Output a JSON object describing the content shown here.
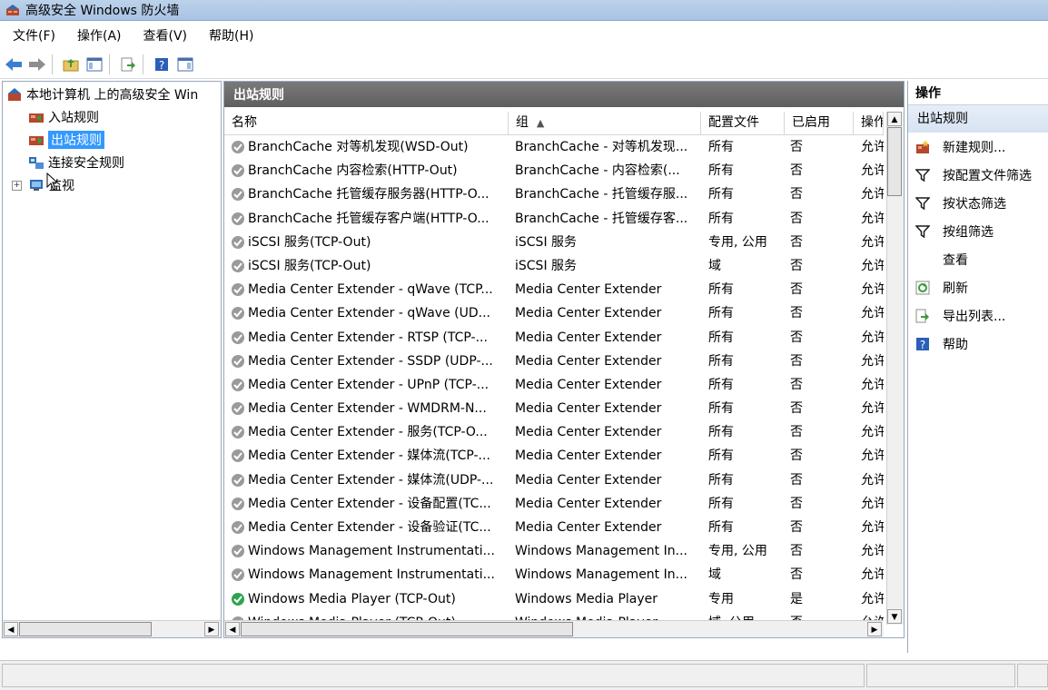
{
  "window": {
    "title": "高级安全 Windows 防火墙"
  },
  "menu": [
    "文件(F)",
    "操作(A)",
    "查看(V)",
    "帮助(H)"
  ],
  "tree": {
    "root": "本地计算机 上的高级安全 Win",
    "inbound": "入站规则",
    "outbound": "出站规则",
    "connection": "连接安全规则",
    "monitor": "监视",
    "expander": "+"
  },
  "center": {
    "title": "出站规则",
    "columns": [
      "名称",
      "组",
      "配置文件",
      "已启用",
      "操作"
    ],
    "sort_indicator": "▲",
    "rows": [
      {
        "name": "BranchCache 对等机发现(WSD-Out)",
        "group": "BranchCache - 对等机发现...",
        "profile": "所有",
        "enabled": "否",
        "action": "允许"
      },
      {
        "name": "BranchCache 内容检索(HTTP-Out)",
        "group": "BranchCache - 内容检索(...",
        "profile": "所有",
        "enabled": "否",
        "action": "允许"
      },
      {
        "name": "BranchCache 托管缓存服务器(HTTP-O...",
        "group": "BranchCache - 托管缓存服...",
        "profile": "所有",
        "enabled": "否",
        "action": "允许"
      },
      {
        "name": "BranchCache 托管缓存客户端(HTTP-O...",
        "group": "BranchCache - 托管缓存客...",
        "profile": "所有",
        "enabled": "否",
        "action": "允许"
      },
      {
        "name": "iSCSI 服务(TCP-Out)",
        "group": "iSCSI 服务",
        "profile": "专用, 公用",
        "enabled": "否",
        "action": "允许"
      },
      {
        "name": "iSCSI 服务(TCP-Out)",
        "group": "iSCSI 服务",
        "profile": "域",
        "enabled": "否",
        "action": "允许"
      },
      {
        "name": "Media Center Extender - qWave (TCP...",
        "group": "Media Center Extender",
        "profile": "所有",
        "enabled": "否",
        "action": "允许"
      },
      {
        "name": "Media Center Extender - qWave (UD...",
        "group": "Media Center Extender",
        "profile": "所有",
        "enabled": "否",
        "action": "允许"
      },
      {
        "name": "Media Center Extender - RTSP (TCP-...",
        "group": "Media Center Extender",
        "profile": "所有",
        "enabled": "否",
        "action": "允许"
      },
      {
        "name": "Media Center Extender - SSDP (UDP-...",
        "group": "Media Center Extender",
        "profile": "所有",
        "enabled": "否",
        "action": "允许"
      },
      {
        "name": "Media Center Extender - UPnP (TCP-...",
        "group": "Media Center Extender",
        "profile": "所有",
        "enabled": "否",
        "action": "允许"
      },
      {
        "name": "Media Center Extender - WMDRM-N...",
        "group": "Media Center Extender",
        "profile": "所有",
        "enabled": "否",
        "action": "允许"
      },
      {
        "name": "Media Center Extender - 服务(TCP-O...",
        "group": "Media Center Extender",
        "profile": "所有",
        "enabled": "否",
        "action": "允许"
      },
      {
        "name": "Media Center Extender - 媒体流(TCP-...",
        "group": "Media Center Extender",
        "profile": "所有",
        "enabled": "否",
        "action": "允许"
      },
      {
        "name": "Media Center Extender - 媒体流(UDP-...",
        "group": "Media Center Extender",
        "profile": "所有",
        "enabled": "否",
        "action": "允许"
      },
      {
        "name": "Media Center Extender - 设备配置(TC...",
        "group": "Media Center Extender",
        "profile": "所有",
        "enabled": "否",
        "action": "允许"
      },
      {
        "name": "Media Center Extender - 设备验证(TC...",
        "group": "Media Center Extender",
        "profile": "所有",
        "enabled": "否",
        "action": "允许"
      },
      {
        "name": "Windows Management Instrumentati...",
        "group": "Windows Management In...",
        "profile": "专用, 公用",
        "enabled": "否",
        "action": "允许"
      },
      {
        "name": "Windows Management Instrumentati...",
        "group": "Windows Management In...",
        "profile": "域",
        "enabled": "否",
        "action": "允许"
      },
      {
        "name": "Windows Media Player (TCP-Out)",
        "group": "Windows Media Player",
        "profile": "专用",
        "enabled": "是",
        "action": "允许",
        "active": true
      },
      {
        "name": "Windows Media Player (TCP-Out)",
        "group": "Windows Media Player",
        "profile": "域, 公用",
        "enabled": "否",
        "action": "允许"
      }
    ]
  },
  "actions": {
    "title": "操作",
    "section": "出站规则",
    "items": [
      {
        "label": "新建规则...",
        "icon": "new-rule-icon"
      },
      {
        "label": "按配置文件筛选",
        "icon": "filter-icon"
      },
      {
        "label": "按状态筛选",
        "icon": "filter-icon"
      },
      {
        "label": "按组筛选",
        "icon": "filter-icon"
      },
      {
        "label": "查看",
        "icon": ""
      },
      {
        "label": "刷新",
        "icon": "refresh-icon"
      },
      {
        "label": "导出列表...",
        "icon": "export-icon"
      },
      {
        "label": "帮助",
        "icon": "help-icon"
      }
    ]
  },
  "colors": {
    "selection": "#3399ff",
    "pane_header": "#6b6b6b",
    "enabled_icon": "#2ea44f",
    "disabled_icon": "#9a9a9a"
  },
  "scroll_arrows": {
    "left": "◀",
    "right": "▶",
    "up": "▲",
    "down": "▼"
  }
}
